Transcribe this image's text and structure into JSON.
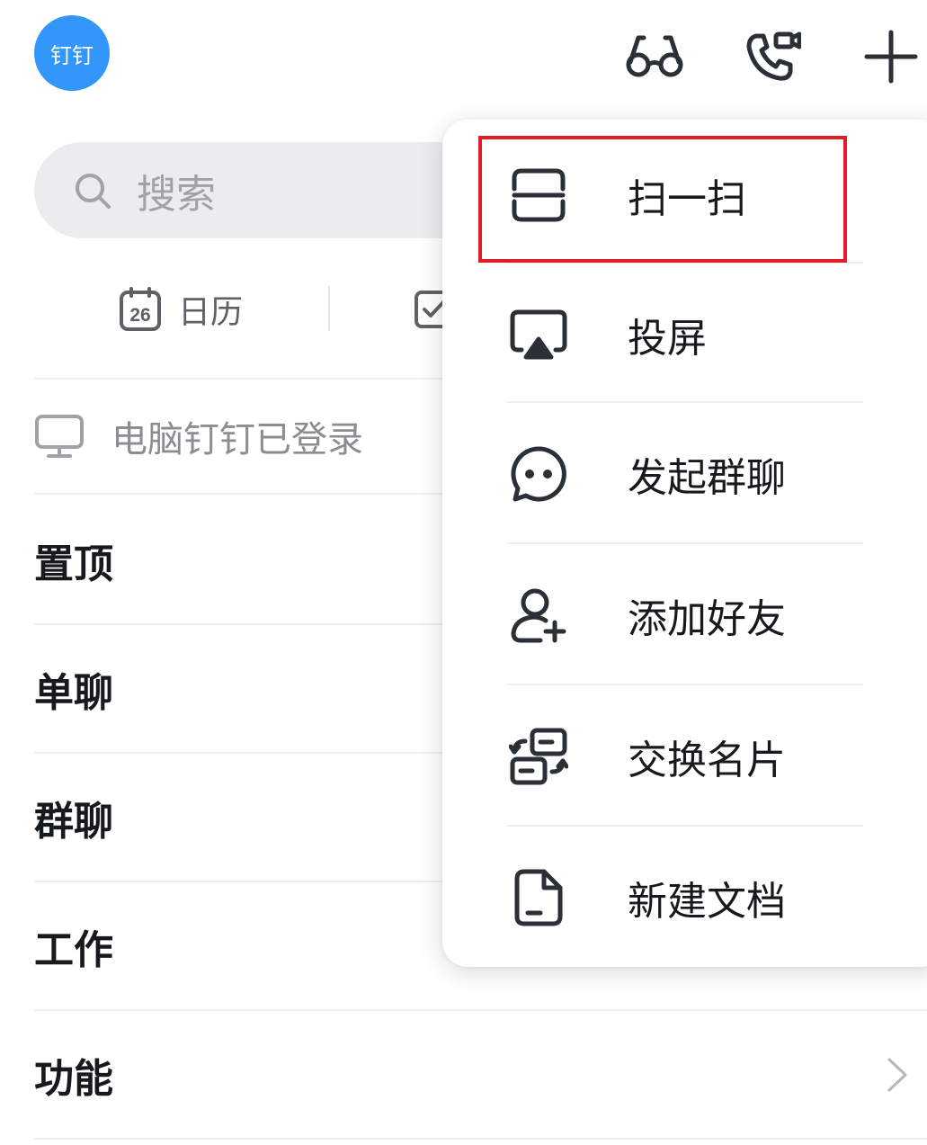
{
  "header": {
    "avatar_text": "钉钉",
    "icons": [
      "glasses-icon",
      "video-call-icon",
      "plus-icon"
    ]
  },
  "search": {
    "placeholder": "搜索"
  },
  "quick_actions": [
    {
      "label": "日历",
      "icon": "calendar-icon",
      "calendar_day": "26"
    },
    {
      "label": "",
      "icon": "todo-check-icon"
    }
  ],
  "login_status": {
    "text": "电脑钉钉已登录",
    "icon": "monitor-icon"
  },
  "sections": [
    {
      "label": "置顶"
    },
    {
      "label": "单聊"
    },
    {
      "label": "群聊"
    },
    {
      "label": "工作"
    },
    {
      "label": "功能"
    }
  ],
  "menu": {
    "items": [
      {
        "label": "扫一扫",
        "icon": "scan-icon"
      },
      {
        "label": "投屏",
        "icon": "screen-cast-icon"
      },
      {
        "label": "发起群聊",
        "icon": "group-chat-icon"
      },
      {
        "label": "添加好友",
        "icon": "add-friend-icon"
      },
      {
        "label": "交换名片",
        "icon": "exchange-card-icon"
      },
      {
        "label": "新建文档",
        "icon": "new-document-icon"
      }
    ],
    "highlighted_item": "扫一扫"
  },
  "colors": {
    "accent": "#3296fa",
    "highlight_border": "#e11d2a",
    "text_primary": "#171a1d",
    "text_secondary": "#8b8d91",
    "search_bg": "#ebecee"
  }
}
